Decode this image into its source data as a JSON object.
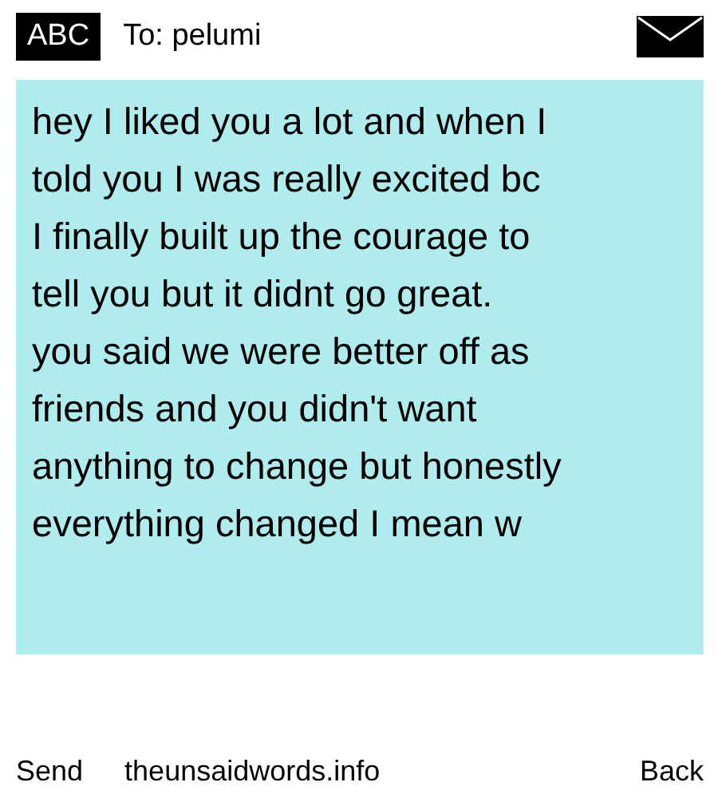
{
  "header": {
    "badge": "ABC",
    "recipient": "To: pelumi"
  },
  "message": {
    "text": "hey I liked you a lot and when I\ntold you I was really excited bc\nI finally built up the courage to\ntell you but it didnt go great.\nyou said we were better off as\nfriends and you didn't want\nanything to change but honestly\neverything changed I mean w"
  },
  "footer": {
    "left": "Send",
    "link": "theunsaidwords.info",
    "right": "Back"
  }
}
